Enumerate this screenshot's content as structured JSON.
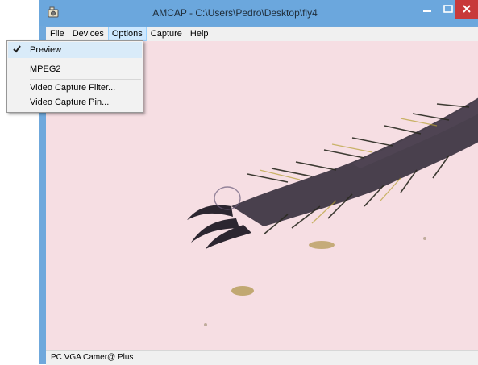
{
  "window": {
    "title": "AMCAP - C:\\Users\\Pedro\\Desktop\\fly4",
    "controls": {
      "minimize_icon": "minimize-icon",
      "maximize_icon": "maximize-icon",
      "close_icon": "close-icon"
    },
    "accent": "#6ba7dd",
    "close_color": "#c8393a"
  },
  "menubar": {
    "items": [
      {
        "label": "File"
      },
      {
        "label": "Devices"
      },
      {
        "label": "Options",
        "active": true
      },
      {
        "label": "Capture"
      },
      {
        "label": "Help"
      }
    ]
  },
  "options_menu": {
    "items": [
      {
        "label": "Preview",
        "checked": true
      },
      {
        "label": "MPEG2"
      },
      {
        "label": "Video Capture Filter..."
      },
      {
        "label": "Video Capture Pin..."
      }
    ]
  },
  "preview": {
    "background": "#f6dee3"
  },
  "statusbar": {
    "text": "PC VGA Camer@ Plus"
  }
}
